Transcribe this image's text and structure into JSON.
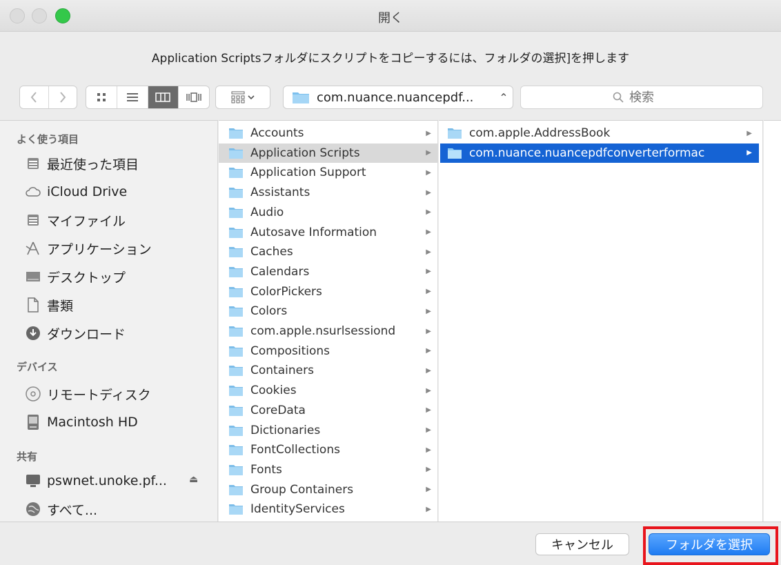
{
  "window": {
    "title": "開く"
  },
  "message": "Application Scriptsフォルダにスクリプトをコピーするには、フォルダの選択]を押します",
  "toolbar": {
    "path": "com.nuance.nuancepdf...",
    "search_placeholder": "検索"
  },
  "sidebar": {
    "favorites_header": "よく使う項目",
    "favorites": [
      {
        "label": "最近使った項目",
        "icon": "recent-icon"
      },
      {
        "label": "iCloud Drive",
        "icon": "cloud-icon"
      },
      {
        "label": "マイファイル",
        "icon": "all-files-icon"
      },
      {
        "label": "アプリケーション",
        "icon": "applications-icon"
      },
      {
        "label": "デスクトップ",
        "icon": "desktop-icon"
      },
      {
        "label": "書類",
        "icon": "documents-icon"
      },
      {
        "label": "ダウンロード",
        "icon": "downloads-icon"
      }
    ],
    "devices_header": "デバイス",
    "devices": [
      {
        "label": "リモートディスク",
        "icon": "remote-disc-icon"
      },
      {
        "label": "Macintosh HD",
        "icon": "hard-drive-icon"
      }
    ],
    "shared_header": "共有",
    "shared": [
      {
        "label": "pswnet.unoke.pf...",
        "icon": "network-computer-icon"
      },
      {
        "label": "すべて...",
        "icon": "network-globe-icon"
      }
    ]
  },
  "column1": [
    "Accounts",
    "Application Scripts",
    "Application Support",
    "Assistants",
    "Audio",
    "Autosave Information",
    "Caches",
    "Calendars",
    "ColorPickers",
    "Colors",
    "com.apple.nsurlsessiond",
    "Compositions",
    "Containers",
    "Cookies",
    "CoreData",
    "Dictionaries",
    "FontCollections",
    "Fonts",
    "Group Containers",
    "IdentityServices"
  ],
  "column2": [
    "com.apple.AddressBook",
    "com.nuance.nuancepdfconverterformac"
  ],
  "buttons": {
    "cancel": "キャンセル",
    "choose": "フォルダを選択"
  },
  "colors": {
    "accent": "#1563d4",
    "highlight": "#e8141c",
    "folder": "#8ec8f0"
  }
}
